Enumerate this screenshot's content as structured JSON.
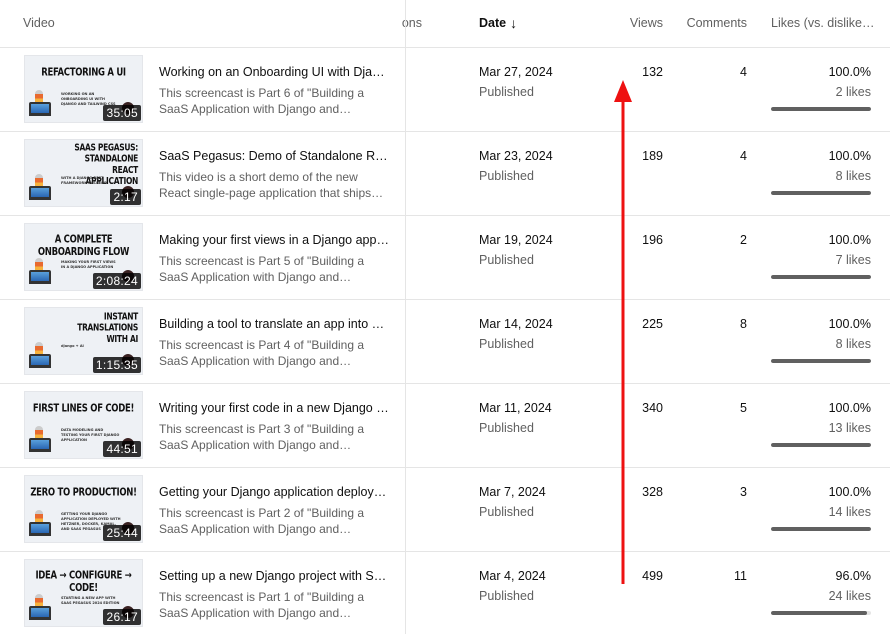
{
  "header": {
    "video": "Video",
    "visibility_partial": "ons",
    "date": "Date",
    "date_sort_icon": "arrow-down-icon",
    "views": "Views",
    "comments": "Comments",
    "likes": "Likes (vs. dislike…"
  },
  "rows": [
    {
      "thumbnail": {
        "title": "REFACTORING A UI",
        "subtitle": "WORKING ON AN ONBOARDING UI WITH DJANGO AND TAILWIND CSS",
        "duration": "35:05"
      },
      "title": "Working on an Onboarding UI with Django and Tailwind CSS",
      "desc1": "This screencast is Part 6 of \"Building a",
      "desc2": "SaaS Application with Django and…",
      "date": "Mar 27, 2024",
      "status": "Published",
      "views": "132",
      "comments": "4",
      "likes_pct": "100.0%",
      "likes": "2 likes",
      "likes_ratio": 1.0
    },
    {
      "thumbnail": {
        "title": "SAAS PEGASUS: STANDALONE REACT APPLICATION",
        "subtitle": "WITH A DJANGO REST FRAMEWORK BACKEND",
        "duration": "2:17"
      },
      "title": "SaaS Pegasus: Demo of Standalone React Application",
      "desc1": "This video is a short demo of the new",
      "desc2": "React single-page application that ships…",
      "date": "Mar 23, 2024",
      "status": "Published",
      "views": "189",
      "comments": "4",
      "likes_pct": "100.0%",
      "likes": "8 likes",
      "likes_ratio": 1.0
    },
    {
      "thumbnail": {
        "title": "A COMPLETE ONBOARDING FLOW",
        "subtitle": "MAKING YOUR FIRST VIEWS IN A DJANGO APPLICATION",
        "duration": "2:08:24"
      },
      "title": "Making your first views in a Django application",
      "desc1": "This screencast is Part 5 of \"Building a",
      "desc2": "SaaS Application with Django and…",
      "date": "Mar 19, 2024",
      "status": "Published",
      "views": "196",
      "comments": "2",
      "likes_pct": "100.0%",
      "likes": "7 likes",
      "likes_ratio": 1.0
    },
    {
      "thumbnail": {
        "title": "INSTANT TRANSLATIONS WITH AI",
        "subtitle": "django + AI",
        "duration": "1:15:35"
      },
      "title": "Building a tool to translate an app into any language",
      "desc1": "This screencast is Part 4 of \"Building a",
      "desc2": "SaaS Application with Django and…",
      "date": "Mar 14, 2024",
      "status": "Published",
      "views": "225",
      "comments": "8",
      "likes_pct": "100.0%",
      "likes": "8 likes",
      "likes_ratio": 1.0
    },
    {
      "thumbnail": {
        "title": "FIRST LINES OF CODE!",
        "subtitle": "DATA MODELING AND TESTING YOUR FIRST DJANGO APPLICATION",
        "duration": "44:51"
      },
      "title": "Writing your first code in a new Django project",
      "desc1": "This screencast is Part 3 of \"Building a",
      "desc2": "SaaS Application with Django and…",
      "date": "Mar 11, 2024",
      "status": "Published",
      "views": "340",
      "comments": "5",
      "likes_pct": "100.0%",
      "likes": "13 likes",
      "likes_ratio": 1.0
    },
    {
      "thumbnail": {
        "title": "ZERO TO PRODUCTION!",
        "subtitle": "GETTING YOUR DJANGO APPLICATION DEPLOYED WITH HETZNER, DOCKER, KAMAL, AND SAAS PEGASUS",
        "duration": "25:44"
      },
      "title": "Getting your Django application deployed to production",
      "desc1": "This screencast is Part 2 of \"Building a",
      "desc2": "SaaS Application with Django and…",
      "date": "Mar 7, 2024",
      "status": "Published",
      "views": "328",
      "comments": "3",
      "likes_pct": "100.0%",
      "likes": "14 likes",
      "likes_ratio": 1.0
    },
    {
      "thumbnail": {
        "title": "IDEA → CONFIGURE → CODE!",
        "subtitle": "STARTING A NEW APP WITH SAAS PEGASUS 2024 EDITION",
        "duration": "26:17"
      },
      "title": "Setting up a new Django project with SaaS Pegasus",
      "desc1": "This screencast is Part 1 of \"Building a",
      "desc2": "SaaS Application with Django and…",
      "date": "Mar 4, 2024",
      "status": "Published",
      "views": "499",
      "comments": "11",
      "likes_pct": "96.0%",
      "likes": "24 likes",
      "likes_ratio": 0.96
    }
  ],
  "annotation": {
    "type": "arrow-up",
    "color": "#ee1111"
  },
  "colors": {
    "text_primary": "#0f0f0f",
    "text_secondary": "#606060",
    "divider": "#e5e5e5",
    "bar_fill": "#606060",
    "bar_track": "#e5e5e5"
  }
}
